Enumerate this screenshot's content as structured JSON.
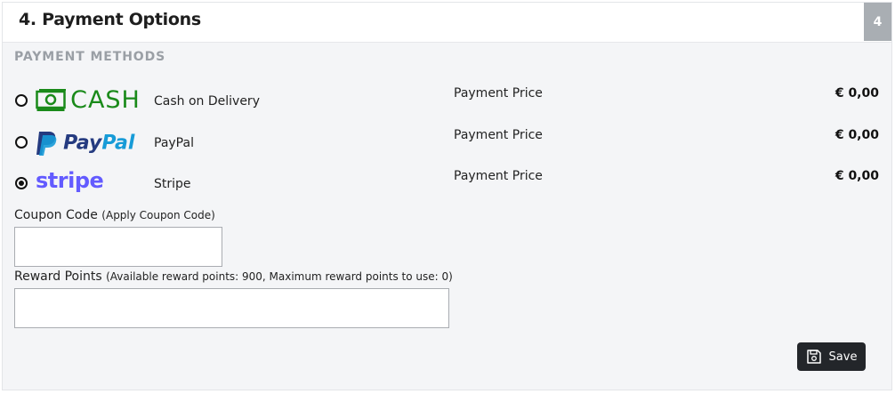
{
  "header": {
    "title": "4. Payment Options",
    "step": "4"
  },
  "section": {
    "label": "PAYMENT METHODS"
  },
  "methods": [
    {
      "logo_text": "CASH",
      "logo_icon": "cash-banknote-icon",
      "name": "Cash on Delivery",
      "price_label": "Payment Price",
      "price": "€ 0,00",
      "selected": false
    },
    {
      "logo_text_pay": "Pay",
      "logo_text_pal": "Pal",
      "logo_icon": "paypal-p-icon",
      "name": "PayPal",
      "price_label": "Payment Price",
      "price": "€ 0,00",
      "selected": false
    },
    {
      "logo_text": "stripe",
      "name": "Stripe",
      "price_label": "Payment Price",
      "price": "€ 0,00",
      "selected": true
    }
  ],
  "coupon": {
    "label": "Coupon Code",
    "hint": "(Apply Coupon Code)",
    "value": ""
  },
  "reward": {
    "label": "Reward Points",
    "hint": "(Available reward points: 900, Maximum reward points to use: 0)",
    "value": ""
  },
  "save": {
    "label": "Save",
    "icon": "floppy-disk-icon"
  },
  "colors": {
    "cash_green": "#1a8a1a",
    "paypal_dark": "#253b80",
    "paypal_light": "#179bd7",
    "stripe_purple": "#635bff",
    "button_bg": "#23262a",
    "badge_bg": "#a9aeb3"
  }
}
